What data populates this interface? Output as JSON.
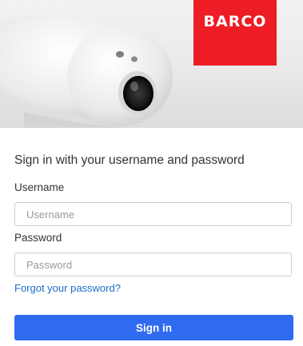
{
  "brand": {
    "logo_text": "BARCO",
    "logo_color": "#ee1c25"
  },
  "form": {
    "title": "Sign in with your username and password",
    "username_label": "Username",
    "username_placeholder": "Username",
    "username_value": "",
    "password_label": "Password",
    "password_placeholder": "Password",
    "password_value": "",
    "forgot_link": "Forgot your password?",
    "submit_label": "Sign in"
  },
  "colors": {
    "accent": "#2f6bf1",
    "link": "#1a6fc8"
  }
}
